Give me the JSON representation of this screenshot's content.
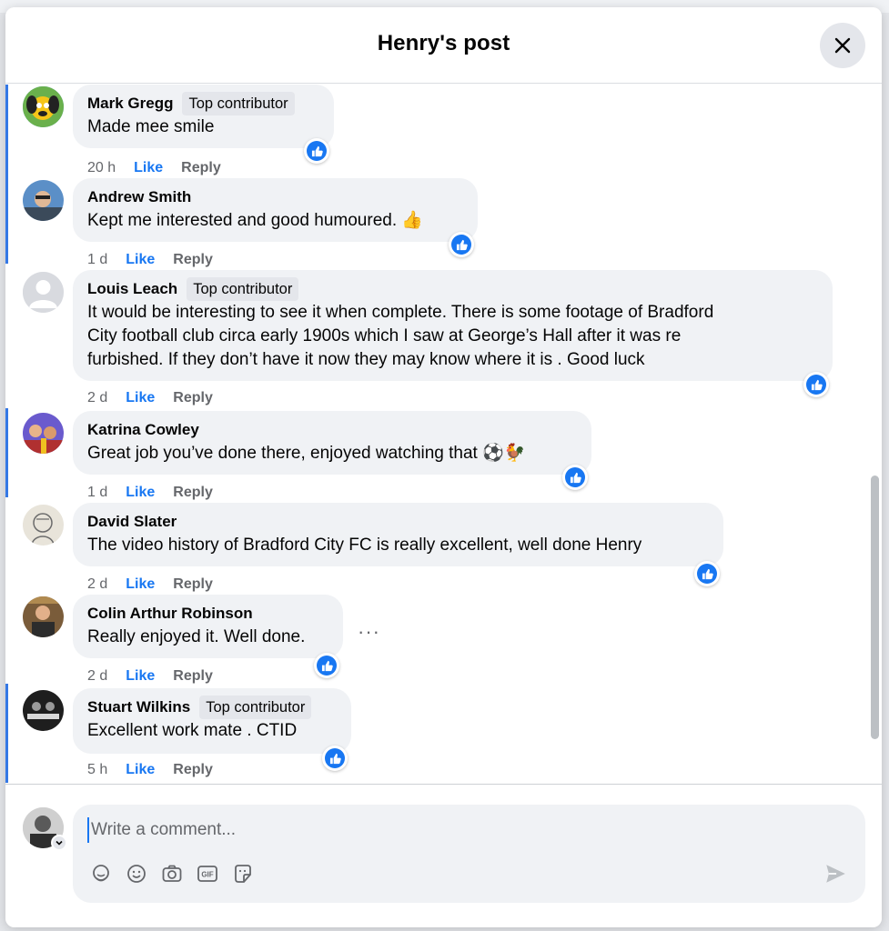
{
  "header": {
    "title": "Henry's post"
  },
  "comments": [
    {
      "name": "Mark Gregg",
      "badge": "Top contributor",
      "text": "Made mee smile",
      "time": "20 h",
      "like": "Like",
      "reply": "Reply"
    },
    {
      "name": "Andrew Smith",
      "badge": "",
      "text": "Kept me interested and good humoured. ",
      "emoji": "👍",
      "time": "1 d",
      "like": "Like",
      "reply": "Reply"
    },
    {
      "name": "Louis Leach",
      "badge": "Top contributor",
      "lines": [
        "It would be interesting to see it when complete. There is some footage of Bradford",
        "City football club circa early 1900s which I saw at George’s Hall after it was re",
        "furbished. If they don’t have it now they may know where it is . Good luck"
      ],
      "time": "2 d",
      "like": "Like",
      "reply": "Reply"
    },
    {
      "name": "Katrina Cowley",
      "badge": "",
      "text": "Great job you’ve done there, enjoyed watching that ",
      "emoji": "⚽🐓",
      "time": "1 d",
      "like": "Like",
      "reply": "Reply"
    },
    {
      "name": "David Slater",
      "badge": "",
      "text": "The video history of Bradford City FC is really excellent, well done Henry",
      "time": "2 d",
      "like": "Like",
      "reply": "Reply"
    },
    {
      "name": "Colin Arthur Robinson",
      "badge": "",
      "text": "Really enjoyed it. Well done.",
      "time": "2 d",
      "like": "Like",
      "reply": "Reply",
      "more": "···"
    },
    {
      "name": "Stuart Wilkins",
      "badge": "Top contributor",
      "text": "Excellent work mate . CTID",
      "time": "5 h",
      "like": "Like",
      "reply": "Reply"
    }
  ],
  "composer": {
    "placeholder": "Write a comment...",
    "icons": [
      "avatar-sticker-icon",
      "emoji-icon",
      "camera-icon",
      "gif-icon",
      "sticker-icon",
      "send-icon"
    ]
  },
  "colors": {
    "accent": "#1877f2",
    "bubble": "#f0f2f5",
    "thread": "#3578e5"
  }
}
